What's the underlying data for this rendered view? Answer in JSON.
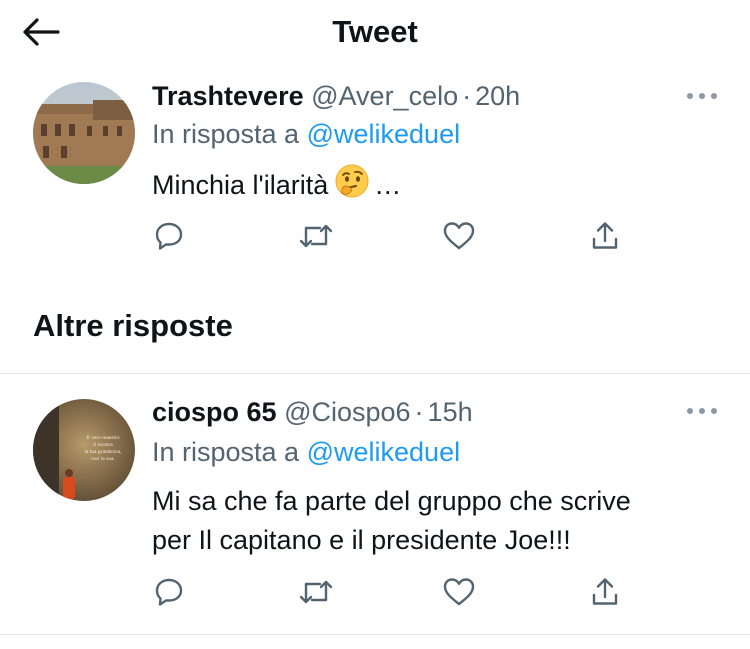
{
  "header": {
    "title": "Tweet",
    "back_icon": "arrow-left-icon"
  },
  "tweets": [
    {
      "display_name": "Trashtevere",
      "handle": "@Aver_celo",
      "separator": "·",
      "time": "20h",
      "reply_prefix": "In risposta a",
      "reply_to": "@welikeduel",
      "text_before_emoji": "Minchia l'ilarità",
      "emoji": "thinking-face-emoji",
      "text_after_emoji": "…"
    },
    {
      "display_name": "ciospo 65",
      "handle": "@Ciospo6",
      "separator": "·",
      "time": "15h",
      "reply_prefix": "In risposta a",
      "reply_to": "@welikeduel",
      "text_line1": "Mi sa che fa parte del gruppo che scrive",
      "text_line2": "per Il capitano e il presidente Joe!!!",
      "avatar_caption": [
        "Il vero maestro",
        "ti mostra",
        "la tua grandezza,",
        "non la sua."
      ]
    }
  ],
  "section": {
    "title": "Altre risposte"
  },
  "colors": {
    "text": "#0f1419",
    "secondary": "#536471",
    "accent": "#1d9bf0",
    "divider": "#dfe3e6"
  }
}
